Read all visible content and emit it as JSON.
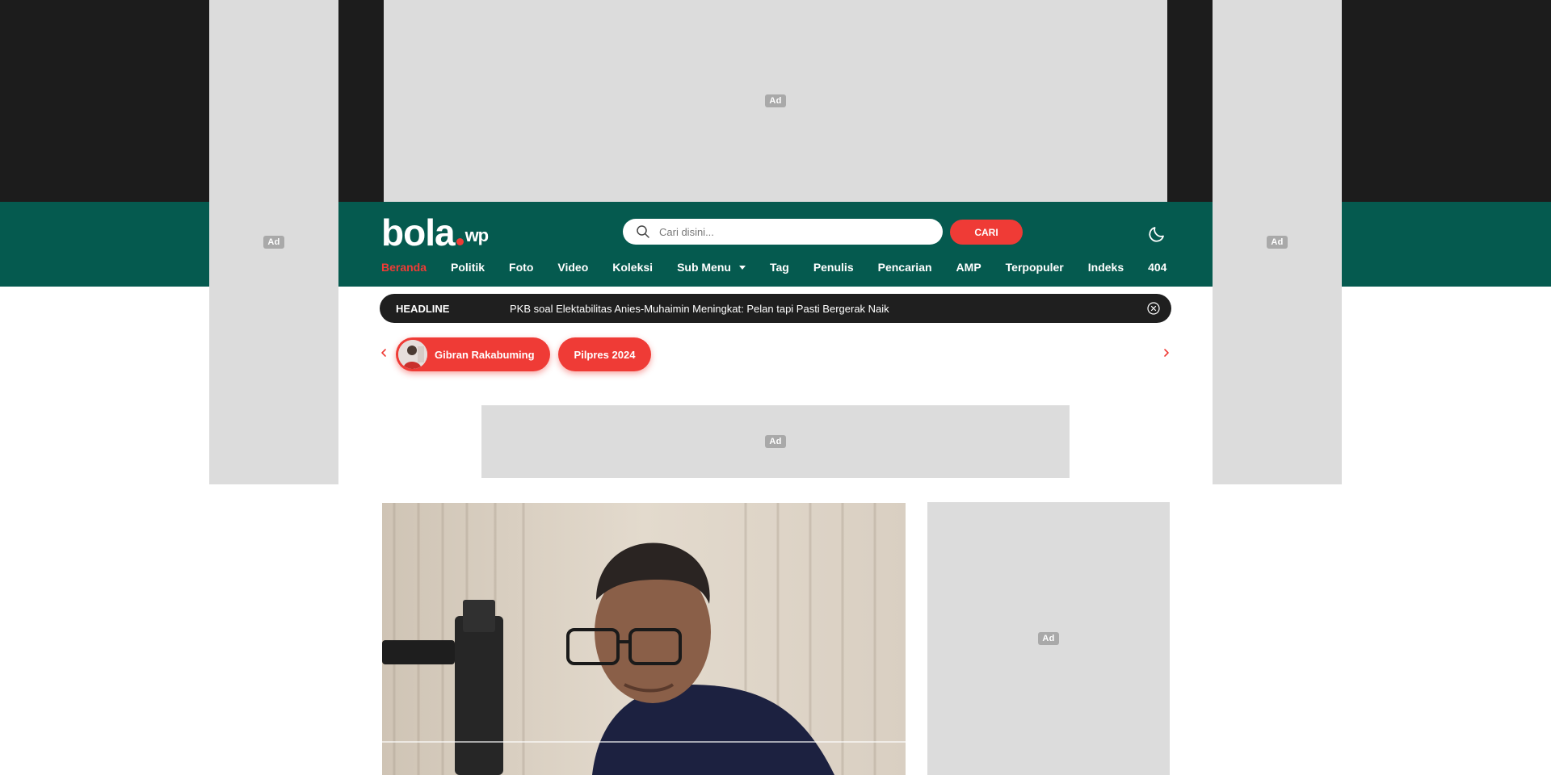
{
  "ads": {
    "label": "Ad"
  },
  "header": {
    "logo": {
      "main": "bola",
      "sub": "wp"
    },
    "search": {
      "placeholder": "Cari disini...",
      "button_label": "CARI"
    },
    "nav": {
      "items": [
        {
          "label": "Beranda",
          "active": true
        },
        {
          "label": "Politik"
        },
        {
          "label": "Foto"
        },
        {
          "label": "Video"
        },
        {
          "label": "Koleksi"
        },
        {
          "label": "Sub Menu",
          "has_dropdown": true
        },
        {
          "label": "Tag"
        },
        {
          "label": "Penulis"
        },
        {
          "label": "Pencarian"
        },
        {
          "label": "AMP"
        },
        {
          "label": "Terpopuler"
        },
        {
          "label": "Indeks"
        },
        {
          "label": "404"
        }
      ]
    }
  },
  "headline": {
    "label": "HEADLINE",
    "text": "PKB soal Elektabilitas Anies-Muhaimin Meningkat: Pelan tapi Pasti Bergerak Naik"
  },
  "topics": [
    {
      "label": "Gibran Rakabuming",
      "has_image": true
    },
    {
      "label": "Pilpres 2024",
      "has_image": false
    }
  ],
  "colors": {
    "green": "#055a4f",
    "accent_red": "#ef3b36",
    "dark": "#1c1c1c",
    "ad_gray": "#dcdcdc"
  },
  "icons": [
    "search-icon",
    "moon-icon",
    "close-icon",
    "chevron-left-icon",
    "chevron-right-icon",
    "chevron-down-icon"
  ]
}
